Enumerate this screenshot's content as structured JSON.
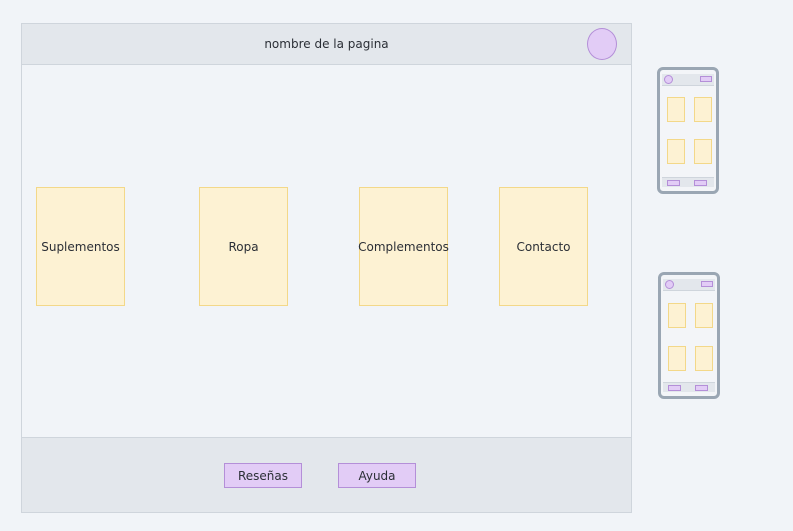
{
  "header": {
    "page_name": "nombre de la pagina"
  },
  "cards": [
    {
      "label": "Suplementos"
    },
    {
      "label": "Ropa"
    },
    {
      "label": "Complementos"
    },
    {
      "label": "Contacto"
    }
  ],
  "footer": {
    "buttons": [
      {
        "label": "Reseñas"
      },
      {
        "label": "Ayuda"
      }
    ]
  },
  "colors": {
    "background": "#f1f4f8",
    "bar": "#e3e7ec",
    "card_fill": "#fdf2d3",
    "card_border": "#f3d889",
    "accent_fill": "#e2ccf6",
    "accent_border": "#b48fd8",
    "phone_frame": "#9aa6b3"
  }
}
